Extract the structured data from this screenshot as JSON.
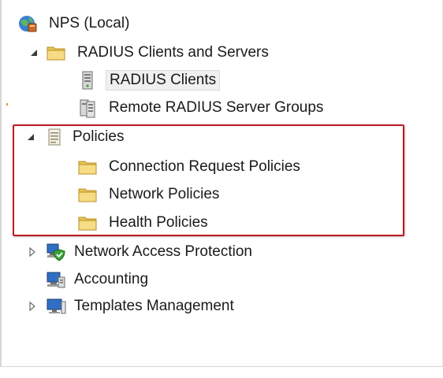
{
  "tree": {
    "root": {
      "label": "NPS (Local)",
      "icon": "globe-server-icon"
    },
    "radius_clients_and_servers": {
      "label": "RADIUS Clients and Servers",
      "icon": "folder-icon",
      "expanded": true,
      "children": [
        {
          "label": "RADIUS Clients",
          "icon": "server-tower-icon",
          "selected": true
        },
        {
          "label": "Remote RADIUS Server Groups",
          "icon": "server-group-icon"
        }
      ]
    },
    "policies": {
      "label": "Policies",
      "icon": "policy-document-icon",
      "expanded": true,
      "children": [
        {
          "label": "Connection Request Policies",
          "icon": "folder-icon"
        },
        {
          "label": "Network Policies",
          "icon": "folder-icon"
        },
        {
          "label": "Health Policies",
          "icon": "folder-icon"
        }
      ]
    },
    "network_access_protection": {
      "label": "Network Access Protection",
      "icon": "nap-shield-icon",
      "expanded": false
    },
    "accounting": {
      "label": "Accounting",
      "icon": "accounting-computer-icon"
    },
    "templates_management": {
      "label": "Templates Management",
      "icon": "templates-monitor-icon",
      "expanded": false
    }
  },
  "colors": {
    "highlight_border": "#c01822",
    "folder_fill": "#f7dc86",
    "selection_bg": "#f0f0f0"
  }
}
